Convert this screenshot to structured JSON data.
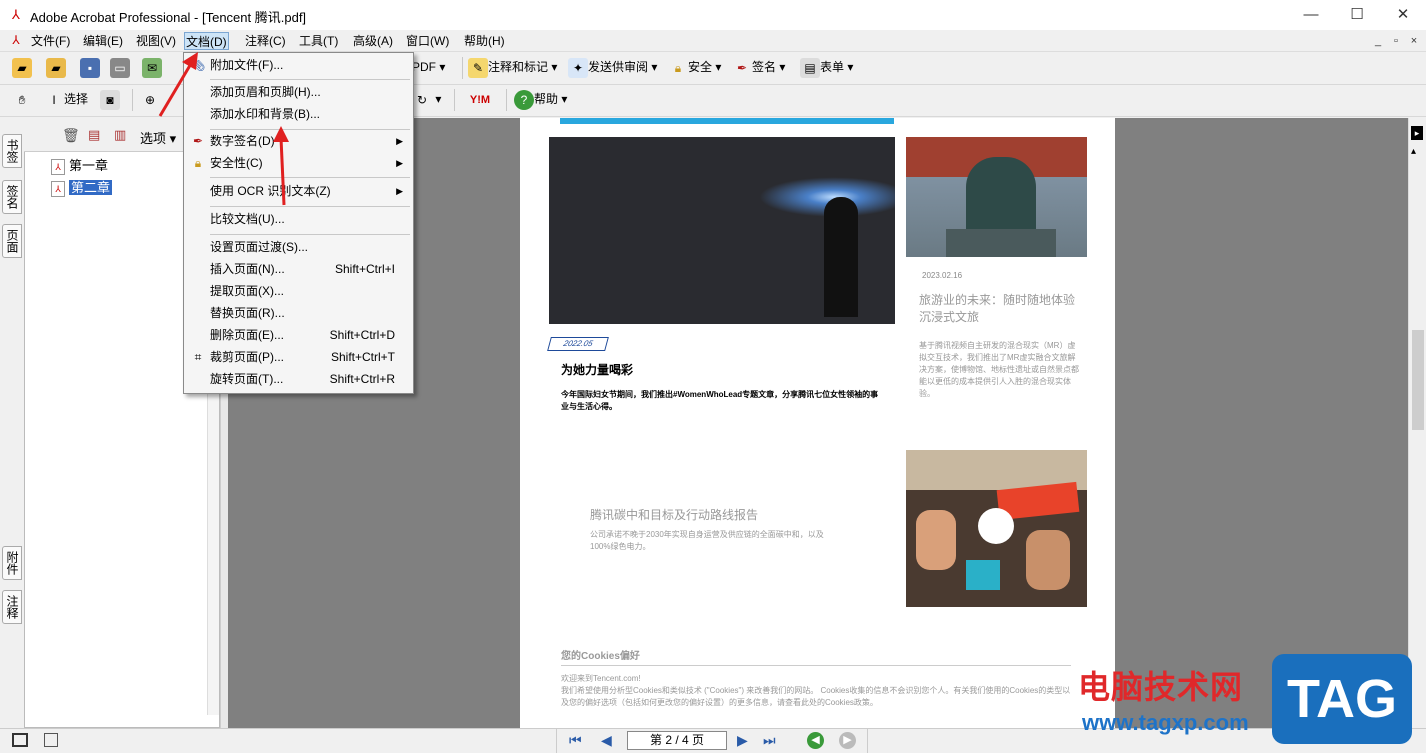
{
  "titlebar": {
    "title": "Adobe Acrobat Professional - [Tencent 腾讯.pdf]",
    "app_icon": "acrobat-icon",
    "min": "—",
    "max": "☐",
    "close": "✕"
  },
  "menubar": {
    "items": [
      "文件(F)",
      "编辑(E)",
      "视图(V)",
      "文档(D)",
      "注释(C)",
      "工具(T)",
      "高级(A)",
      "窗口(W)",
      "帮助(H)"
    ],
    "mdi_controls": [
      "_",
      "▫",
      "×"
    ]
  },
  "toolbar1": {
    "create_pdf": "PDF",
    "comment_mark": "注释和标记",
    "send_review": "发送供审阅",
    "security": "安全",
    "sign": "签名",
    "forms": "表单"
  },
  "toolbar2": {
    "hand": "",
    "select": "选择",
    "help": "帮助"
  },
  "navpanel": {
    "options_label": "选项",
    "tabs_top": [
      "书签",
      "签名",
      "页面"
    ],
    "tabs_bottom": [
      "附件",
      "注释"
    ],
    "bookmarks": [
      {
        "label": "第一章",
        "selected": false
      },
      {
        "label": "第二章",
        "selected": true
      }
    ]
  },
  "dropdown": {
    "items": [
      {
        "label": "附加文件(F)...",
        "shortcut": "",
        "submenu": false,
        "icon": "paperclip-icon"
      },
      {
        "label": "添加页眉和页脚(H)...",
        "shortcut": "",
        "submenu": false,
        "icon": ""
      },
      {
        "label": "添加水印和背景(B)...",
        "shortcut": "",
        "submenu": false,
        "icon": ""
      },
      {
        "label": "数字签名(D)",
        "shortcut": "",
        "submenu": true,
        "icon": "pen-icon"
      },
      {
        "label": "安全性(C)",
        "shortcut": "",
        "submenu": true,
        "icon": "lock-icon"
      },
      {
        "label": "使用 OCR 识别文本(Z)",
        "shortcut": "",
        "submenu": true,
        "icon": ""
      },
      {
        "label": "比较文档(U)...",
        "shortcut": "",
        "submenu": false,
        "icon": ""
      },
      {
        "label": "设置页面过渡(S)...",
        "shortcut": "",
        "submenu": false,
        "icon": ""
      },
      {
        "label": "插入页面(N)...",
        "shortcut": "Shift+Ctrl+I",
        "submenu": false,
        "icon": ""
      },
      {
        "label": "提取页面(X)...",
        "shortcut": "",
        "submenu": false,
        "icon": ""
      },
      {
        "label": "替换页面(R)...",
        "shortcut": "",
        "submenu": false,
        "icon": ""
      },
      {
        "label": "删除页面(E)...",
        "shortcut": "Shift+Ctrl+D",
        "submenu": false,
        "icon": ""
      },
      {
        "label": "裁剪页面(P)...",
        "shortcut": "Shift+Ctrl+T",
        "submenu": false,
        "icon": "crop-icon"
      },
      {
        "label": "旋转页面(T)...",
        "shortcut": "Shift+Ctrl+R",
        "submenu": false,
        "icon": ""
      }
    ]
  },
  "page": {
    "date1": "2022.05",
    "heading1": "为她力量喝彩",
    "body1": "今年国际妇女节期间，我们推出#WomenWhoLead专题文章，分享腾讯七位女性领袖的事业与生活心得。",
    "date2": "2023.02.16",
    "heading2": "旅游业的未来：随时随地体验沉浸式文旅",
    "body2": "基于腾讯视频自主研发的混合现实（MR）虚拟交互技术，我们推出了MR虚实融合文旅解决方案，使博物馆、地标性遗址或自然景点都能以更低的成本提供引人入胜的混合现实体验。",
    "heading3": "腾讯碳中和目标及行动路线报告",
    "body3": "公司承诺不晚于2030年实现自身运营及供应链的全面碳中和，以及100%绿色电力。",
    "cookies_title": "您的Cookies偏好",
    "cookies_welcome": "欢迎来到Tencent.com!",
    "cookies_body": "我们希望使用分析型Cookies和类似技术 (\"Cookies\") 来改善我们的网站。 Cookies收集的信息不会识别您个人。有关我们使用的Cookies的类型以及您的偏好选项（包括如何更改您的偏好设置）的更多信息，请查看此处的Cookies政策。"
  },
  "statusbar": {
    "page_indicator": "第 2 / 4 页"
  },
  "watermark": {
    "line1": "电脑技术网",
    "line2": "www.tagxp.com",
    "tag": "TAG"
  }
}
